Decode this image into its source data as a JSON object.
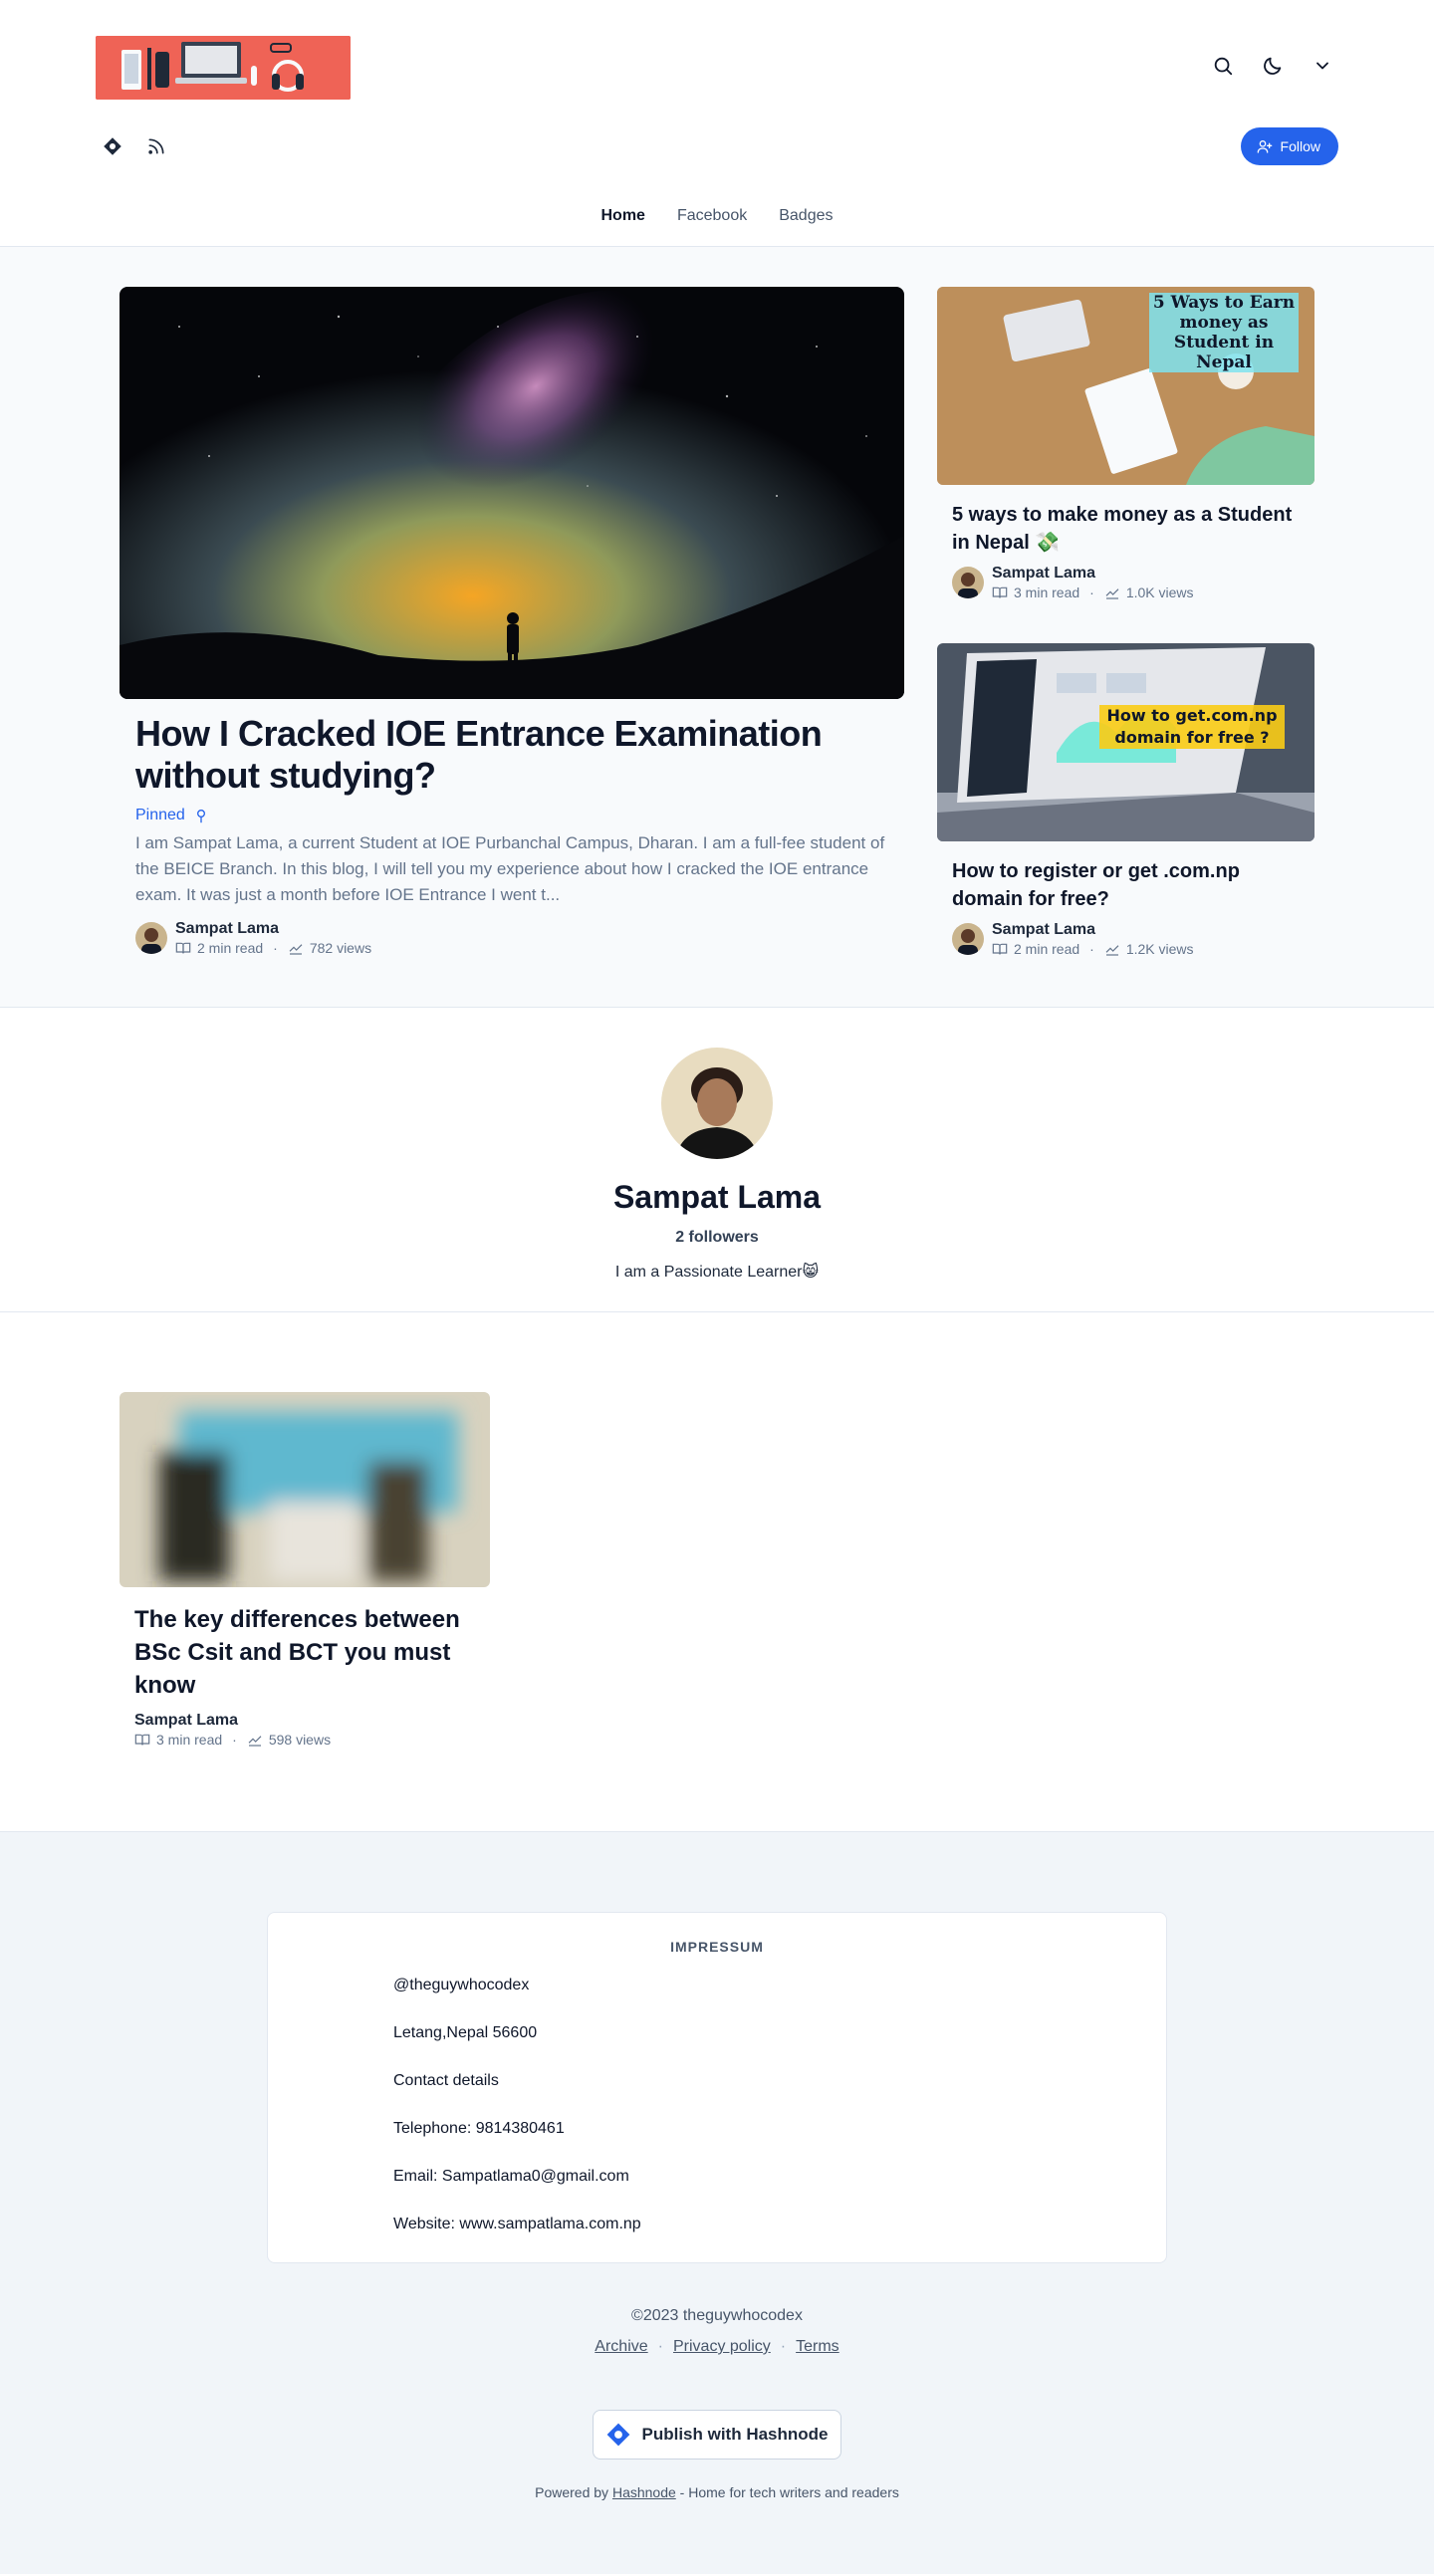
{
  "header": {
    "follow_label": "Follow",
    "nav": [
      "Home",
      "Facebook",
      "Badges"
    ]
  },
  "featured": {
    "title": "How I Cracked IOE Entrance Examination without studying?",
    "pinned_label": "Pinned",
    "excerpt": "I am Sampat Lama, a current Student at IOE Purbanchal Campus, Dharan. I am a full-fee student of the BEICE Branch. In this blog, I will tell you my experience about how I cracked the IOE entrance exam. It was just a month before IOE Entrance I went t...",
    "author": "Sampat Lama",
    "read_time": "2 min read",
    "views": "782 views"
  },
  "side_posts": [
    {
      "title": "5 ways to make money as a Student in Nepal 💸",
      "cover_text": "5 Ways to Earn money as Student in Nepal",
      "author": "Sampat Lama",
      "read_time": "3 min read",
      "views": "1.0K views"
    },
    {
      "title": "How to register or get .com.np domain for free?",
      "cover_text": "How to get.com.np domain for free ?",
      "author": "Sampat Lama",
      "read_time": "2 min read",
      "views": "1.2K views"
    }
  ],
  "profile": {
    "name": "Sampat Lama",
    "followers": "2 followers",
    "bio": "I am a Passionate Learner😸"
  },
  "posts": [
    {
      "title": "The key differences between BSc Csit and BCT you must know",
      "author": "Sampat Lama",
      "read_time": "3 min read",
      "views": "598 views"
    }
  ],
  "footer": {
    "impressum_title": "IMPRESSUM",
    "impressum_lines": [
      "@theguywhocodex",
      "Letang,Nepal 56600",
      "Contact details",
      "Telephone: 9814380461",
      "Email: Sampatlama0@gmail.com",
      "Website: www.sampatlama.com.np"
    ],
    "copyright": "©2023 theguywhocodex",
    "links": [
      "Archive",
      "Privacy policy",
      "Terms"
    ],
    "publish_label": "Publish with Hashnode",
    "powered_prefix": "Powered by",
    "powered_link": "Hashnode",
    "powered_suffix": "- Home for tech writers and readers"
  },
  "colors": {
    "accent": "#2563eb",
    "logo_bg": "#ef6356"
  }
}
